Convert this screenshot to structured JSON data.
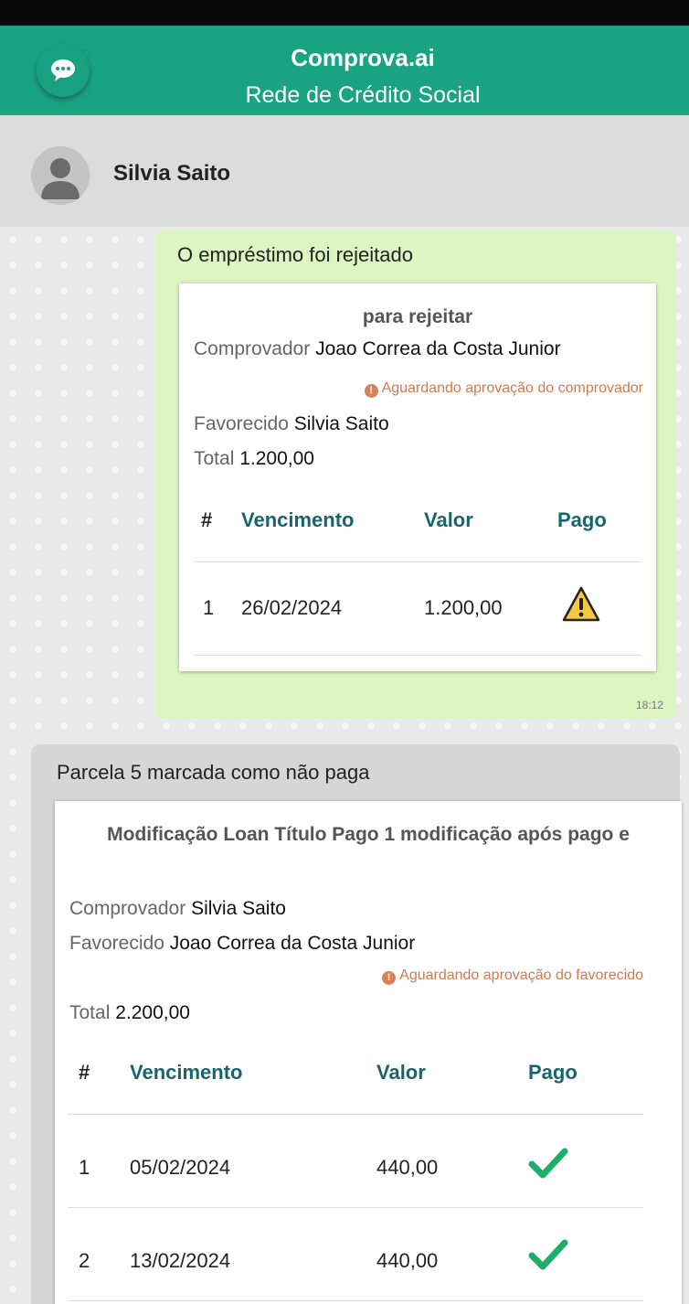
{
  "app": {
    "title": "Comprova.ai",
    "subtitle": "Rede de Crédito Social"
  },
  "contact": {
    "name": "Silvia Saito"
  },
  "messages": [
    {
      "title": "O empréstimo foi rejeitado",
      "time": "18:12",
      "card": {
        "heading": "para rejeitar",
        "comprovador_label": "Comprovador",
        "comprovador": "Joao Correa da Costa Junior",
        "status": "Aguardando aprovação do comprovador",
        "favorecido_label": "Favorecido",
        "favorecido": "Silvia Saito",
        "total_label": "Total",
        "total": "1.200,00",
        "columns": [
          "#",
          "Vencimento",
          "Valor",
          "Pago"
        ],
        "rows": [
          {
            "n": "1",
            "due": "26/02/2024",
            "value": "1.200,00",
            "paid_icon": "warning-icon"
          }
        ]
      }
    },
    {
      "title": "Parcela 5 marcada como não paga",
      "card": {
        "heading": "Modificação Loan Título Pago 1 modificação após pago e",
        "comprovador_label": "Comprovador",
        "comprovador": "Silvia Saito",
        "favorecido_label": "Favorecido",
        "favorecido": "Joao Correa da Costa Junior",
        "status": "Aguardando aprovação do favorecido",
        "total_label": "Total",
        "total": "2.200,00",
        "columns": [
          "#",
          "Vencimento",
          "Valor",
          "Pago"
        ],
        "rows": [
          {
            "n": "1",
            "due": "05/02/2024",
            "value": "440,00",
            "paid_icon": "check-icon"
          },
          {
            "n": "2",
            "due": "13/02/2024",
            "value": "440,00",
            "paid_icon": "check-icon"
          }
        ]
      }
    }
  ],
  "colors": {
    "header": "#1aa383",
    "bubble_out": "#dcf5c3",
    "bubble_in": "#d6d6d6",
    "table_header": "#16666b",
    "pending": "#d17a4f",
    "check": "#1fae6a"
  }
}
